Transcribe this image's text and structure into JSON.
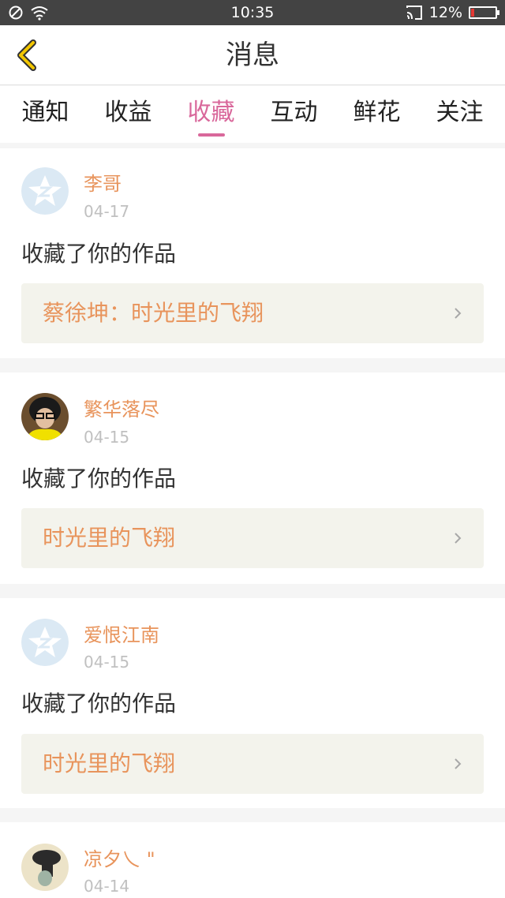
{
  "status_bar": {
    "time": "10:35",
    "battery_text": "12%",
    "battery_level": 0.12,
    "battery_color": "#e53935"
  },
  "header": {
    "title": "消息",
    "accent_color": "#f2c600"
  },
  "tabs": [
    {
      "label": "通知",
      "active": false
    },
    {
      "label": "收益",
      "active": false
    },
    {
      "label": "收藏",
      "active": true
    },
    {
      "label": "互动",
      "active": false
    },
    {
      "label": "鲜花",
      "active": false
    },
    {
      "label": "关注",
      "active": false
    }
  ],
  "colors": {
    "active_tab": "#d9689b",
    "username": "#e8945c",
    "work_title": "#e8945c",
    "date": "#c0c0c0"
  },
  "messages": [
    {
      "avatar": "default-qzone-avatar",
      "username": "李哥",
      "date": "04-17",
      "action": "收藏了你的作品",
      "work": "蔡徐坤：时光里的飞翔"
    },
    {
      "avatar": "user-photo-avatar",
      "username": "繁华落尽",
      "date": "04-15",
      "action": "收藏了你的作品",
      "work": "时光里的飞翔"
    },
    {
      "avatar": "default-qzone-avatar",
      "username": "爱恨江南",
      "date": "04-15",
      "action": "收藏了你的作品",
      "work": "时光里的飞翔"
    },
    {
      "avatar": "user-photo-avatar",
      "username": "凉夕乀 \"",
      "date": "04-14"
    }
  ]
}
